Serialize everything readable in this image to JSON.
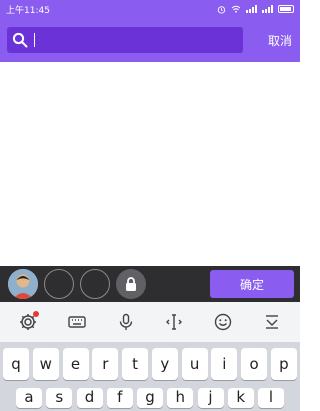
{
  "status_bar": {
    "time": "上午11:45"
  },
  "search": {
    "value": "",
    "cancel_label": "取消"
  },
  "selection_bar": {
    "confirm_label": "确定"
  },
  "keyboard": {
    "row1": [
      "q",
      "w",
      "e",
      "r",
      "t",
      "y",
      "u",
      "i",
      "o",
      "p"
    ],
    "row2": [
      "a",
      "s",
      "d",
      "f",
      "g",
      "h",
      "j",
      "k",
      "l"
    ]
  },
  "colors": {
    "accent": "#8a5cf0",
    "search_bg": "#6b32d8",
    "selection_bar_bg": "#2e2e31"
  }
}
